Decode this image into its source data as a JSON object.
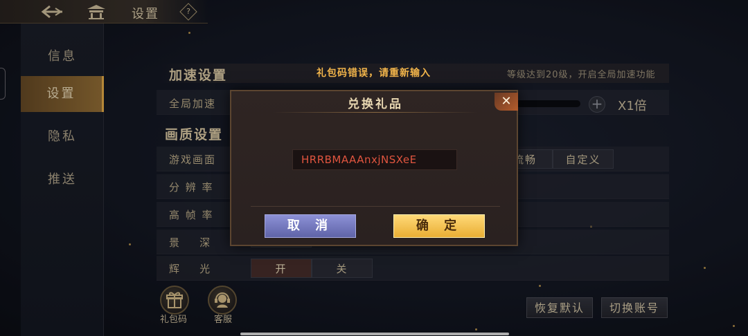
{
  "topbar": {
    "title": "设置",
    "back_icon": "back-arrow-icon",
    "home_icon": "pavilion-icon",
    "help_icon": "?"
  },
  "sidebar": {
    "items": [
      {
        "label": "信息"
      },
      {
        "label": "设置"
      },
      {
        "label": "隐私"
      },
      {
        "label": "推送"
      }
    ],
    "active_index": 1
  },
  "accel": {
    "title": "加速设置",
    "hint": "等级达到20级，开启全局加速功能",
    "row_label": "全局加速",
    "multiplier": "X1倍"
  },
  "toast": "礼包码错误，请重新输入",
  "quality": {
    "title": "画质设置",
    "rows": [
      {
        "label": "游戏画面"
      },
      {
        "label": "分 辨 率"
      },
      {
        "label": "高 帧 率"
      },
      {
        "label": "景    深"
      },
      {
        "label": "辉    光"
      }
    ],
    "game_screen_options": [
      "流畅",
      "自定义"
    ],
    "glow_options": [
      "开",
      "关"
    ]
  },
  "bottom": {
    "gift_code_label": "礼包码",
    "support_label": "客服",
    "restore_default": "恢复默认",
    "switch_account": "切换账号"
  },
  "dialog": {
    "title": "兑换礼品",
    "close": "✕",
    "code_value": "HRRBMAAAnxjNSXeE",
    "cancel": "取 消",
    "confirm": "确 定"
  },
  "colors": {
    "accent_gold": "#f2b54b",
    "error_red": "#e0553f",
    "cancel_blue": "#7378c0"
  }
}
